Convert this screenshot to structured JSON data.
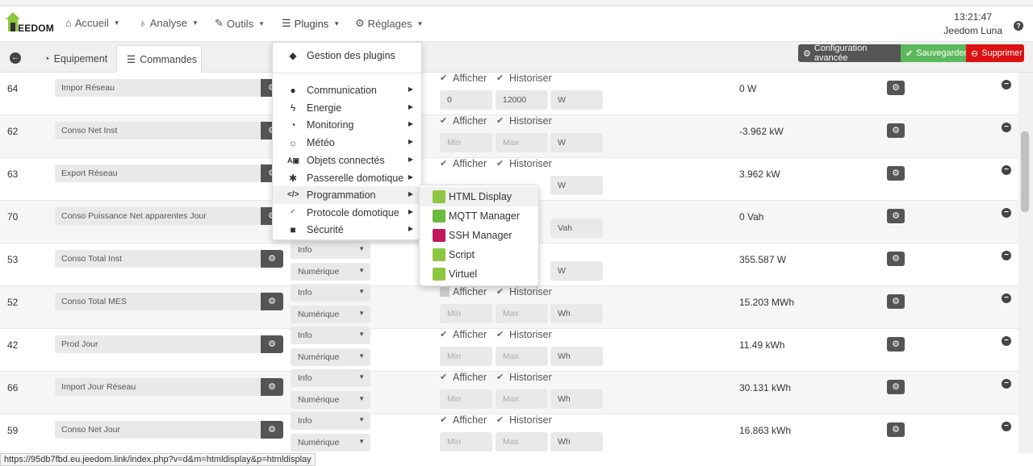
{
  "nav": {
    "brand": "EEDOM",
    "items": [
      {
        "label": "Accueil",
        "icon": "home-icon"
      },
      {
        "label": "Analyse",
        "icon": "stethoscope-icon"
      },
      {
        "label": "Outils",
        "icon": "wrench-icon"
      },
      {
        "label": "Plugins",
        "icon": "list-icon"
      },
      {
        "label": "Réglages",
        "icon": "gear-icon"
      }
    ],
    "clock": "13:21:47",
    "user": "Jeedom Luna"
  },
  "pagebar": {
    "tab_equipment": "Equipement",
    "tab_commands": "Commandes",
    "btn_advanced": "Configuration avancée",
    "btn_save": "Sauvegarder",
    "btn_delete": "Supprimer"
  },
  "labels": {
    "afficher": "Afficher",
    "historiser": "Historiser",
    "min_placeholder": "Min",
    "max_placeholder": "Max"
  },
  "rows": [
    {
      "id": "64",
      "name": "Impor Réseau",
      "type": "",
      "subtype": "",
      "min": "0",
      "max": "12000",
      "unit": "W",
      "value": "0 W",
      "afficher": true
    },
    {
      "id": "62",
      "name": "Conso Net Inst",
      "type": "",
      "subtype": "",
      "min": "",
      "max": "",
      "unit": "W",
      "value": "-3.962 kW",
      "afficher": true
    },
    {
      "id": "63",
      "name": "Export Réseau",
      "type": "",
      "subtype": "",
      "min": "",
      "max": "",
      "unit": "W",
      "value": "3.962 kW",
      "afficher": true
    },
    {
      "id": "70",
      "name": "Conso Puissance Net apparentes Jour",
      "type": "",
      "subtype": "",
      "min": "",
      "max": "",
      "unit": "Vah",
      "value": "0 Vah",
      "afficher": true
    },
    {
      "id": "53",
      "name": "Conso Total Inst",
      "type": "Info",
      "subtype": "Numérique",
      "min": "",
      "max": "",
      "unit": "W",
      "value": "355.587 W",
      "afficher": true
    },
    {
      "id": "52",
      "name": "Conso Total MES",
      "type": "Info",
      "subtype": "Numérique",
      "min": "",
      "max": "",
      "unit": "Wh",
      "value": "15.203 MWh",
      "afficher": false
    },
    {
      "id": "42",
      "name": "Prod Jour",
      "type": "Info",
      "subtype": "Numérique",
      "min": "",
      "max": "",
      "unit": "Wh",
      "value": "11.49 kWh",
      "afficher": true
    },
    {
      "id": "66",
      "name": "Import Jour Réseau",
      "type": "Info",
      "subtype": "Numérique",
      "min": "",
      "max": "",
      "unit": "Wh",
      "value": "30.131 kWh",
      "afficher": true
    },
    {
      "id": "59",
      "name": "Conso Net Jour",
      "type": "Info",
      "subtype": "Numérique",
      "min": "",
      "max": "",
      "unit": "Wh",
      "value": "16.863 kWh",
      "afficher": true
    }
  ],
  "plugin_menu": {
    "header": "Gestion des plugins",
    "categories": [
      {
        "label": "Communication",
        "icon": "comment-icon"
      },
      {
        "label": "Energie",
        "icon": "bolt-icon"
      },
      {
        "label": "Monitoring",
        "icon": "dashboard-icon"
      },
      {
        "label": "Météo",
        "icon": "sun-icon"
      },
      {
        "label": "Objets connectés",
        "icon": "connected-objects-icon"
      },
      {
        "label": "Passerelle domotique",
        "icon": "asterisk-icon"
      },
      {
        "label": "Programmation",
        "icon": "code-icon"
      },
      {
        "label": "Protocole domotique",
        "icon": "rss-icon"
      },
      {
        "label": "Sécurité",
        "icon": "lock-icon"
      }
    ]
  },
  "submenu": {
    "items": [
      {
        "label": "HTML Display",
        "color": "#8dc63f"
      },
      {
        "label": "MQTT Manager",
        "color": "#6dbb3e"
      },
      {
        "label": "SSH Manager",
        "color": "#c2185b"
      },
      {
        "label": "Script",
        "color": "#8dc63f"
      },
      {
        "label": "Virtuel",
        "color": "#8dc63f"
      }
    ]
  },
  "status_url": "https://95db7fbd.eu.jeedom.link/index.php?v=d&m=htmldisplay&p=htmldisplay"
}
